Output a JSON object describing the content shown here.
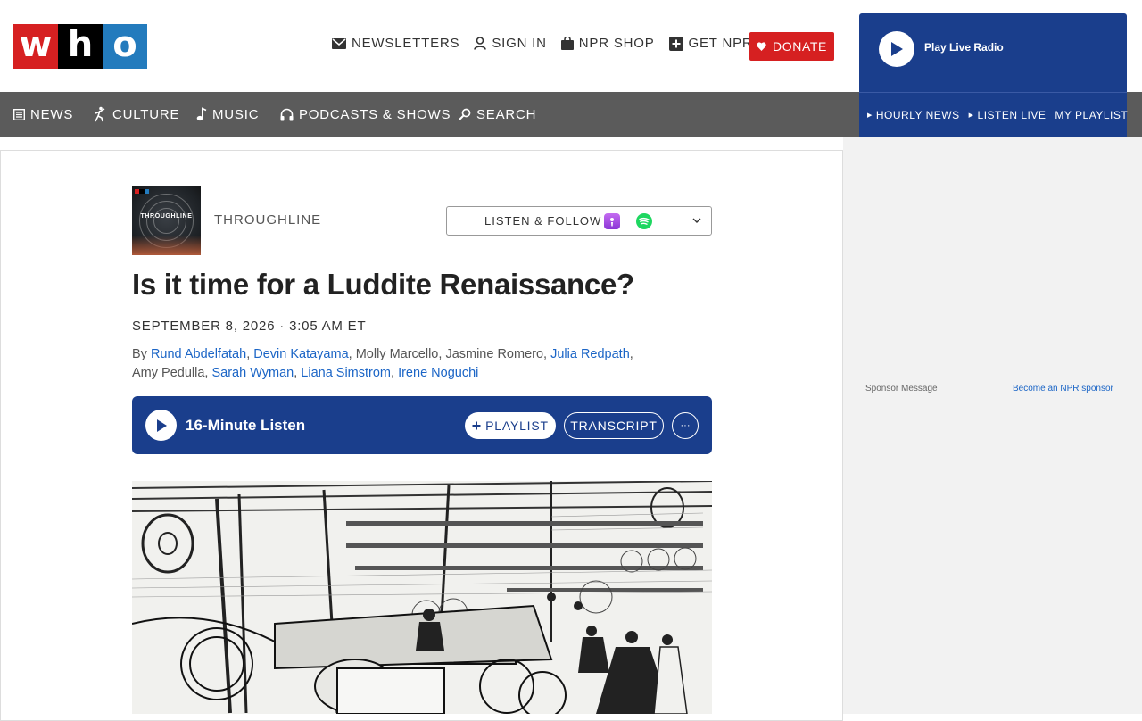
{
  "logo": {
    "letters": [
      "w",
      "h",
      "o"
    ]
  },
  "utility": {
    "newsletters": "NEWSLETTERS",
    "sign_in": "SIGN IN",
    "shop": "NPR SHOP",
    "get_plus": "GET NPR+"
  },
  "donate": "DONATE",
  "live_radio": {
    "label": "Play Live Radio",
    "links": [
      "HOURLY NEWS",
      "LISTEN LIVE",
      "MY PLAYLIST"
    ]
  },
  "nav": {
    "news": "NEWS",
    "culture": "CULTURE",
    "music": "MUSIC",
    "podcasts": "PODCASTS & SHOWS",
    "search": "SEARCH"
  },
  "podcast": {
    "name": "THROUGHLINE",
    "art_title": "THROUGHLINE",
    "follow_label": "LISTEN & FOLLOW"
  },
  "article": {
    "headline": "Is it time for a Luddite Renaissance?",
    "date": "SEPTEMBER 8, 2026 · 3:05 AM ET",
    "by": "By",
    "authors": [
      {
        "name": "Rund Abdelfatah",
        "linked": true
      },
      {
        "name": "Devin Katayama",
        "linked": true
      },
      {
        "name": "Molly Marcello",
        "linked": false
      },
      {
        "name": "Jasmine Romero",
        "linked": false
      },
      {
        "name": "Julia Redpath",
        "linked": true
      },
      {
        "name": "Amy Pedulla",
        "linked": false
      },
      {
        "name": "Sarah Wyman",
        "linked": true
      },
      {
        "name": "Liana Simstrom",
        "linked": true
      },
      {
        "name": "Irene Noguchi",
        "linked": true
      }
    ]
  },
  "audio": {
    "duration": "16-Minute Listen",
    "playlist": "PLAYLIST",
    "transcript": "TRANSCRIPT",
    "more": "···"
  },
  "sidebar": {
    "sponsor_message": "Sponsor Message",
    "become_sponsor": "Become an NPR sponsor"
  },
  "colors": {
    "brand_red": "#d62021",
    "brand_blue": "#237bbd",
    "nav_gray": "#5b5b5b",
    "live_blue": "#1a3e8c",
    "link_blue": "#1b65c6"
  }
}
